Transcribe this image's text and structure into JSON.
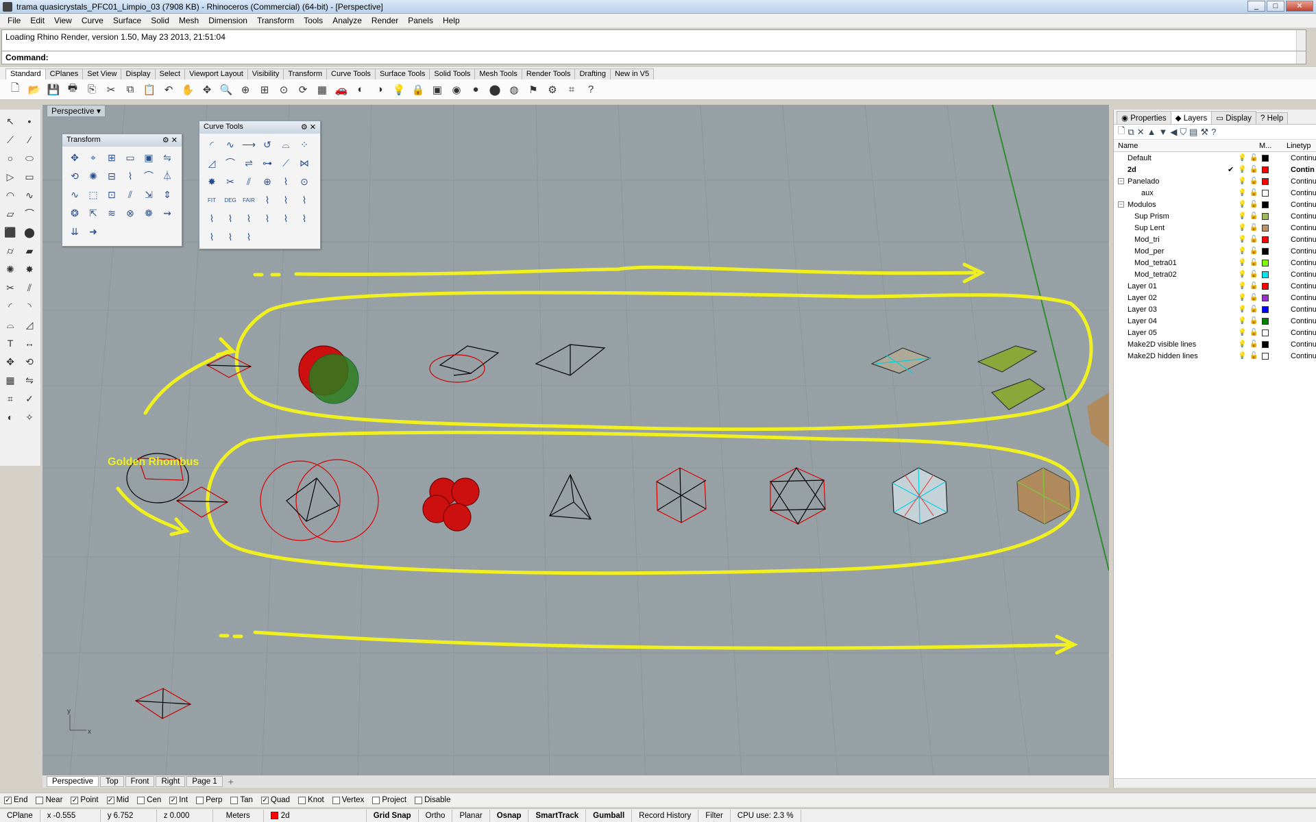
{
  "window": {
    "title": "trama quasicrystals_PFC01_Limpio_03 (7908 KB) - Rhinoceros (Commercial) (64-bit) - [Perspective]"
  },
  "menu": [
    "File",
    "Edit",
    "View",
    "Curve",
    "Surface",
    "Solid",
    "Mesh",
    "Dimension",
    "Transform",
    "Tools",
    "Analyze",
    "Render",
    "Panels",
    "Help"
  ],
  "command": {
    "history": "Loading Rhino Render, version 1.50, May 23 2013, 21:51:04",
    "label": "Command:",
    "value": ""
  },
  "toolbar_tabs": [
    "Standard",
    "CPlanes",
    "Set View",
    "Display",
    "Select",
    "Viewport Layout",
    "Visibility",
    "Transform",
    "Curve Tools",
    "Surface Tools",
    "Solid Tools",
    "Mesh Tools",
    "Render Tools",
    "Drafting",
    "New in V5"
  ],
  "active_toolbar_tab": "Standard",
  "standard_icons": [
    "new-icon",
    "open-icon",
    "save-icon",
    "print-icon",
    "import-icon",
    "cut-icon",
    "copy-icon",
    "paste-icon",
    "undo-icon",
    "pan-icon",
    "move-icon",
    "zoom-dynamic-icon",
    "zoom-window-icon",
    "zoom-extents-icon",
    "zoom-selected-icon",
    "rotate-view-icon",
    "four-viewports-icon",
    "car-icon",
    "hide-icon",
    "show-icon",
    "light-icon",
    "lock-icon",
    "render-icon",
    "color-icon",
    "material-icon",
    "sphere-icon",
    "render-preview-icon",
    "toolbar-icon",
    "settings-icon",
    "analysis-icon",
    "help-icon"
  ],
  "viewport": {
    "label": "Perspective",
    "annotation": "Golden Rhombus",
    "axis_y": "y",
    "axis_x": "x"
  },
  "floating": {
    "transform": {
      "title": "Transform"
    },
    "curvetools": {
      "title": "Curve Tools",
      "labels": [
        "FIT",
        "DEG",
        "FAIR"
      ]
    }
  },
  "viewport_tabs": [
    "Perspective",
    "Top",
    "Front",
    "Right",
    "Page 1"
  ],
  "active_viewport_tab": "Perspective",
  "panel": {
    "tabs": [
      "Properties",
      "Layers",
      "Display",
      "Help"
    ],
    "active_tab": "Layers",
    "columns": {
      "name": "Name",
      "material": "M...",
      "linetype": "Linetyp"
    }
  },
  "layers": [
    {
      "name": "Default",
      "indent": 0,
      "color": "#000000",
      "linetype": "Continu"
    },
    {
      "name": "2d",
      "indent": 0,
      "color": "#ff0000",
      "linetype": "Contin",
      "current": true
    },
    {
      "name": "Panelado",
      "indent": 0,
      "color": "#ff0000",
      "linetype": "Continu",
      "expand": "−"
    },
    {
      "name": "aux",
      "indent": 2,
      "color": "#ffffff",
      "linetype": "Continu"
    },
    {
      "name": "Modulos",
      "indent": 0,
      "color": "#000000",
      "linetype": "Continu",
      "expand": "−"
    },
    {
      "name": "Sup Prism",
      "indent": 1,
      "color": "#9bbb59",
      "linetype": "Continu"
    },
    {
      "name": "Sup Lent",
      "indent": 1,
      "color": "#c0926a",
      "linetype": "Continu"
    },
    {
      "name": "Mod_tri",
      "indent": 1,
      "color": "#ff0000",
      "linetype": "Continu"
    },
    {
      "name": "Mod_per",
      "indent": 1,
      "color": "#000000",
      "linetype": "Continu"
    },
    {
      "name": "Mod_tetra01",
      "indent": 1,
      "color": "#7fff00",
      "linetype": "Continu"
    },
    {
      "name": "Mod_tetra02",
      "indent": 1,
      "color": "#00e5ee",
      "linetype": "Continu"
    },
    {
      "name": "Layer 01",
      "indent": 0,
      "color": "#ff0000",
      "linetype": "Continu"
    },
    {
      "name": "Layer 02",
      "indent": 0,
      "color": "#9932cc",
      "linetype": "Continu"
    },
    {
      "name": "Layer 03",
      "indent": 0,
      "color": "#0000ff",
      "linetype": "Continu"
    },
    {
      "name": "Layer 04",
      "indent": 0,
      "color": "#008000",
      "linetype": "Continu"
    },
    {
      "name": "Layer 05",
      "indent": 0,
      "color": "#ffffff",
      "linetype": "Continu"
    },
    {
      "name": "Make2D visible lines",
      "indent": 0,
      "color": "#000000",
      "linetype": "Continu"
    },
    {
      "name": "Make2D hidden lines",
      "indent": 0,
      "color": "#ffffff",
      "linetype": "Continu"
    }
  ],
  "osnaps": [
    {
      "label": "End",
      "checked": true
    },
    {
      "label": "Near",
      "checked": false
    },
    {
      "label": "Point",
      "checked": true
    },
    {
      "label": "Mid",
      "checked": true
    },
    {
      "label": "Cen",
      "checked": false
    },
    {
      "label": "Int",
      "checked": true
    },
    {
      "label": "Perp",
      "checked": false
    },
    {
      "label": "Tan",
      "checked": false
    },
    {
      "label": "Quad",
      "checked": true
    },
    {
      "label": "Knot",
      "checked": false
    },
    {
      "label": "Vertex",
      "checked": false
    },
    {
      "label": "Project",
      "checked": false
    },
    {
      "label": "Disable",
      "checked": false
    }
  ],
  "status": {
    "cplane": "CPlane",
    "x": "x -0.555",
    "y": "y 6.752",
    "z": "z 0.000",
    "units": "Meters",
    "layer": "2d",
    "layer_color": "#ff0000",
    "toggles": [
      {
        "label": "Grid Snap",
        "on": true
      },
      {
        "label": "Ortho",
        "on": false
      },
      {
        "label": "Planar",
        "on": false
      },
      {
        "label": "Osnap",
        "on": true
      },
      {
        "label": "SmartTrack",
        "on": true
      },
      {
        "label": "Gumball",
        "on": true
      },
      {
        "label": "Record History",
        "on": false
      },
      {
        "label": "Filter",
        "on": false
      }
    ],
    "cpu": "CPU use: 2.3 %"
  }
}
